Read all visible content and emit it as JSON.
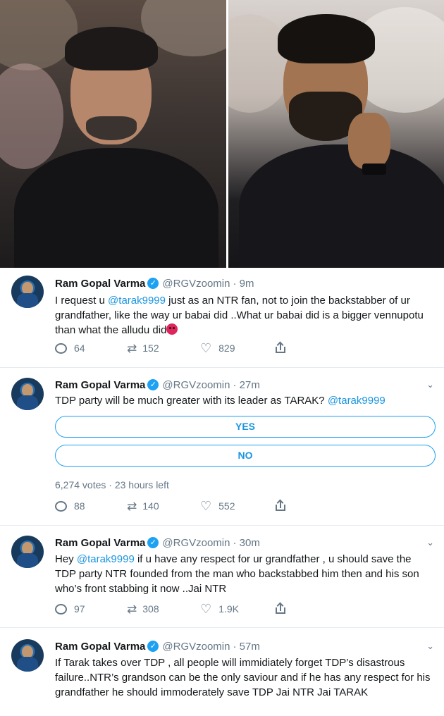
{
  "tweets": [
    {
      "name": "Ram Gopal Varma",
      "handle": "@RGVzoomin",
      "time": "· 9m",
      "text_a": "I request u ",
      "mention_a": "@tarak9999",
      "text_b": " just as an NTR fan, not to join the backstabber of ur grandfather, like the way ur babai did ..What ur babai did is a bigger vennupotu than what the alludu did",
      "reply_count": "64",
      "retweet_count": "152",
      "like_count": "829"
    },
    {
      "name": "Ram Gopal Varma",
      "handle": "@RGVzoomin",
      "time": "· 27m",
      "text_a": "TDP party will be much greater with its leader as TARAK? ",
      "mention_a": "@tarak9999",
      "poll_options": [
        "YES",
        "NO"
      ],
      "poll_meta": "6,274 votes · 23 hours left",
      "reply_count": "88",
      "retweet_count": "140",
      "like_count": "552"
    },
    {
      "name": "Ram Gopal Varma",
      "handle": "@RGVzoomin",
      "time": "· 30m",
      "text_a": "Hey ",
      "mention_a": "@tarak9999",
      "text_b": " if u have any respect for ur grandfather , u should save the TDP party NTR founded from the man who backstabbed him then and his son who’s front stabbing it now ..Jai NTR",
      "reply_count": "97",
      "retweet_count": "308",
      "like_count": "1.9K"
    },
    {
      "name": "Ram Gopal Varma",
      "handle": "@RGVzoomin",
      "time": "· 57m",
      "text_a": "If Tarak takes over TDP , all people will immidiately forget TDP’s disastrous failure..NTR’s grandson can be the only saviour and if he has any respect for his grandfather he should immoderately save TDP Jai NTR Jai TARAK"
    }
  ],
  "icons": {
    "verified": "verified-badge-icon",
    "chevron": "chevron-down-icon",
    "reply": "reply-icon",
    "retweet": "retweet-icon",
    "like": "heart-icon",
    "share": "share-icon",
    "emoji": "angry-face-emoji"
  },
  "colors": {
    "accent": "#1da1f2",
    "link": "#1b95e0",
    "muted": "#657786",
    "text": "#14171a",
    "border": "#e6ecf0"
  }
}
